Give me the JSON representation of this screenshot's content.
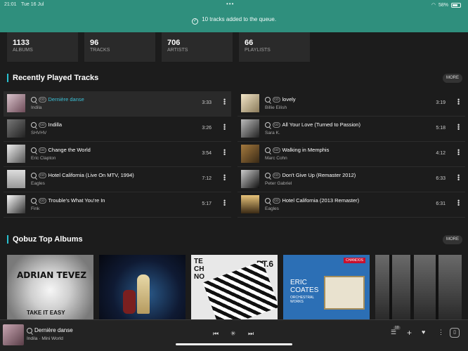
{
  "status": {
    "time": "21:01",
    "date": "Tue 16 Jul",
    "battery": "58%"
  },
  "toast": {
    "message": "10 tracks added to the queue."
  },
  "stats": [
    {
      "count": "1133",
      "label": "ALBUMS"
    },
    {
      "count": "96",
      "label": "TRACKS"
    },
    {
      "count": "706",
      "label": "ARTISTS"
    },
    {
      "count": "66",
      "label": "PLAYLISTS"
    }
  ],
  "recent": {
    "title": "Recently Played Tracks",
    "more_label": "MORE",
    "left": [
      {
        "title": "Dernière danse",
        "artist": "Indila",
        "duration": "3:33",
        "active": true
      },
      {
        "title": "Indilla",
        "artist": "SHVHV",
        "duration": "3:26"
      },
      {
        "title": "Change the World",
        "artist": "Eric Clapton",
        "duration": "3:54"
      },
      {
        "title": "Hotel California (Live On MTV, 1994)",
        "artist": "Eagles",
        "duration": "7:12"
      },
      {
        "title": "Trouble's What You're In",
        "artist": "Fink",
        "duration": "5:17"
      }
    ],
    "right": [
      {
        "title": "lovely",
        "artist": "Billie Eilish",
        "duration": "3:19"
      },
      {
        "title": "All Your Love (Turned to Passion)",
        "artist": "Sara K.",
        "duration": "5:18"
      },
      {
        "title": "Walking in Memphis",
        "artist": "Marc Cohn",
        "duration": "4:12"
      },
      {
        "title": "Don't Give Up (Remaster 2012)",
        "artist": "Peter Gabriel",
        "duration": "6:33"
      },
      {
        "title": "Hotel California  (2013 Remaster)",
        "artist": "Eagles",
        "duration": "6:31"
      }
    ],
    "cd_tag": "CD"
  },
  "top_albums": {
    "title": "Qobuz Top Albums",
    "more_label": "MORE",
    "album1_text1": "ADRIAN TEVEZ",
    "album1_text2": "TAKE IT EASY",
    "album3_text1": "TECHNO",
    "album3_text2": "PT.6",
    "album4_label": "CHANDOS",
    "album4_text1": "ERIC",
    "album4_text2": "COATES",
    "album4_text3": "ORCHESTRAL",
    "album4_text4": "WORKS"
  },
  "player": {
    "title": "Dernière danse",
    "subtitle": "Indila · Mini World",
    "queue_count": "10"
  },
  "colors": {
    "accent": "#28c2d1",
    "toast": "#2f8f7d"
  }
}
